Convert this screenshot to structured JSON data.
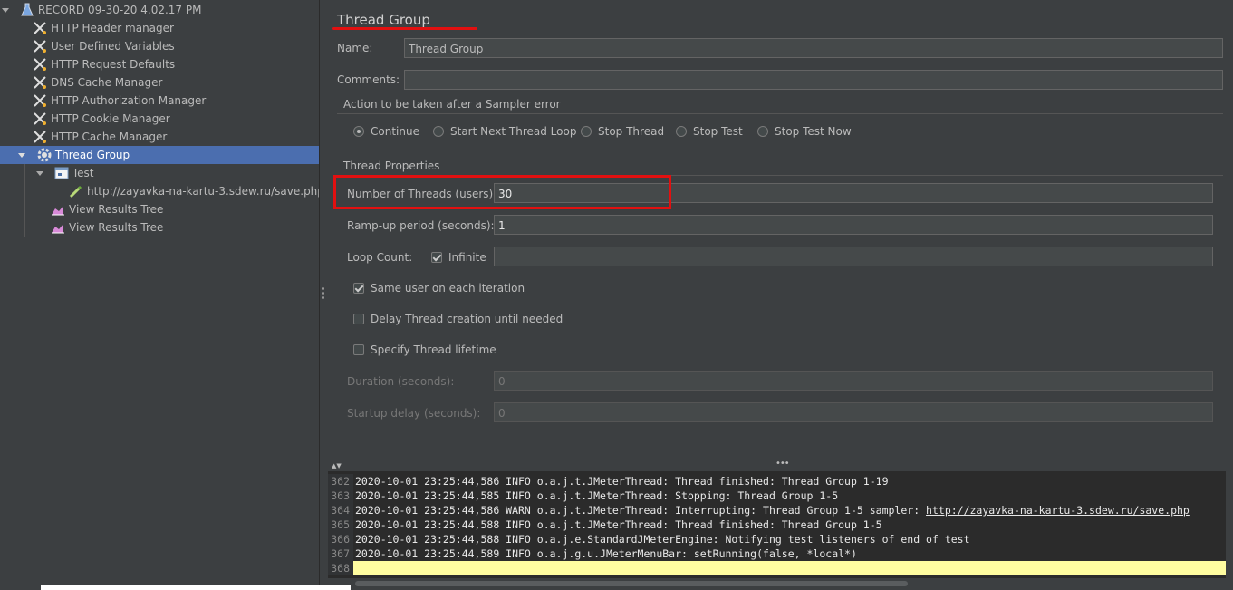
{
  "tree": {
    "root": "RECORD 09-30-20 4.02.17 PM",
    "config_items": [
      "HTTP Header manager",
      "User Defined Variables",
      "HTTP Request Defaults",
      "DNS Cache Manager",
      "HTTP Authorization Manager",
      "HTTP Cookie Manager",
      "HTTP Cache Manager"
    ],
    "thread_group": "Thread Group",
    "controller": "Test",
    "sampler": "http://zayavka-na-kartu-3.sdew.ru/save.php",
    "listeners": [
      "View Results Tree",
      "View Results Tree"
    ]
  },
  "panel": {
    "title": "Thread Group",
    "name_label": "Name:",
    "name_value": "Thread Group",
    "comments_label": "Comments:",
    "comments_value": "",
    "action_section": "Action to be taken after a Sampler error",
    "actions": [
      "Continue",
      "Start Next Thread Loop",
      "Stop Thread",
      "Stop Test",
      "Stop Test Now"
    ],
    "selected_action": "Continue",
    "props_section": "Thread Properties",
    "threads_label": "Number of Threads (users):",
    "threads_value": "30",
    "rampup_label": "Ramp-up period (seconds):",
    "rampup_value": "1",
    "loop_label": "Loop Count:",
    "infinite_label": "Infinite",
    "loop_value": "",
    "same_user_label": "Same user on each iteration",
    "delay_label": "Delay Thread creation until needed",
    "lifetime_label": "Specify Thread lifetime",
    "duration_label": "Duration (seconds):",
    "duration_value": "0",
    "startup_label": "Startup delay (seconds):",
    "startup_value": "0"
  },
  "log": {
    "lines": [
      {
        "num": "362",
        "text": "2020-10-01 23:25:44,586 INFO o.a.j.t.JMeterThread: Thread finished: Thread Group 1-19"
      },
      {
        "num": "363",
        "text": "2020-10-01 23:25:44,585 INFO o.a.j.t.JMeterThread: Stopping: Thread Group 1-5"
      },
      {
        "num": "364",
        "text": "2020-10-01 23:25:44,586 WARN o.a.j.t.JMeterThread: Interrupting: Thread Group 1-5 sampler: ",
        "link": "http://zayavka-na-kartu-3.sdew.ru/save.php"
      },
      {
        "num": "365",
        "text": "2020-10-01 23:25:44,588 INFO o.a.j.t.JMeterThread: Thread finished: Thread Group 1-5"
      },
      {
        "num": "366",
        "text": "2020-10-01 23:25:44,588 INFO o.a.j.e.StandardJMeterEngine: Notifying test listeners of end of test"
      },
      {
        "num": "367",
        "text": "2020-10-01 23:25:44,589 INFO o.a.j.g.u.JMeterMenuBar: setRunning(false, *local*)"
      },
      {
        "num": "368",
        "text": ""
      }
    ]
  },
  "colors": {
    "selection": "#4b6eaf",
    "highlight": "#e21010",
    "current_line": "#fffda0"
  }
}
